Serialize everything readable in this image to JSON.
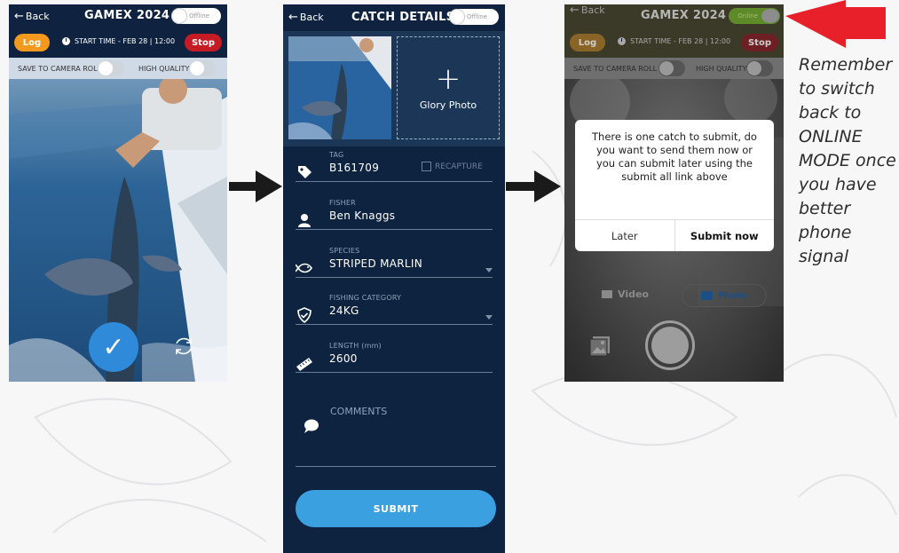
{
  "screen1": {
    "back_label": "Back",
    "title": "GAMEX 2024",
    "mode_label": "Offline",
    "log_label": "Log",
    "start_time": "START TIME - FEB 28 | 12:00",
    "stop_label": "Stop",
    "save_to_camera_roll": "SAVE TO CAMERA ROLL",
    "high_quality": "HIGH QUALITY"
  },
  "screen2": {
    "back_label": "Back",
    "title": "CATCH DETAILS",
    "mode_label": "Offline",
    "glory_photo_label": "Glory Photo",
    "fields": [
      {
        "label": "TAG",
        "value": "B161709"
      },
      {
        "label": "FISHER",
        "value": "Ben Knaggs"
      },
      {
        "label": "SPECIES",
        "value": "STRIPED MARLIN"
      },
      {
        "label": "FISHING CATEGORY",
        "value": "24KG"
      },
      {
        "label": "LENGTH (mm)",
        "value": "2600"
      }
    ],
    "recapture_label": "RECAPTURE",
    "comments_label": "COMMENTS",
    "submit_label": "SUBMIT"
  },
  "screen3": {
    "back_label": "Back",
    "title": "GAMEX 2024",
    "mode_label": "Online",
    "log_label": "Log",
    "start_time": "START TIME - FEB 28 | 12:00",
    "stop_label": "Stop",
    "save_to_camera_roll": "SAVE TO CAMERA ROLL",
    "high_quality": "HIGH QUALITY",
    "dialog_message": "There is one catch to submit, do you want to send them now or you can submit later using the submit all link above",
    "later_label": "Later",
    "submit_now_label": "Submit now",
    "video_label": "Video",
    "photo_label": "Photo"
  },
  "note": "Remember to switch back to ONLINE MODE once you have better phone signal",
  "colors": {
    "header_navy": "#0f2340",
    "log_orange": "#f39a1e",
    "stop_red": "#c61a24",
    "submit_blue": "#3aa0e0",
    "check_blue": "#2f8bd9",
    "online_green": "#5f8a2a",
    "callout_red": "#e8202a"
  }
}
